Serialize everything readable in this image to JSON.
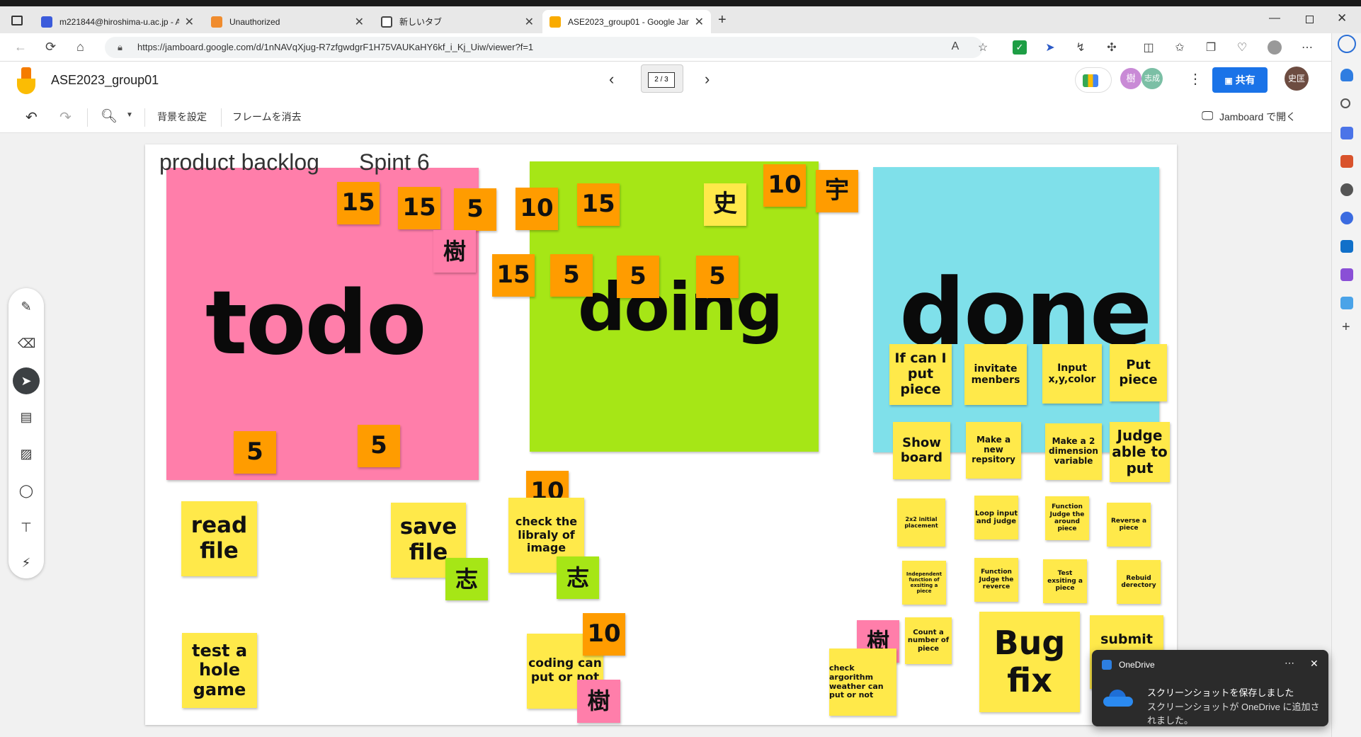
{
  "browser": {
    "tabs": [
      {
        "title": "m221844@hiroshima-u.ac.jp - A"
      },
      {
        "title": "Unauthorized"
      },
      {
        "title": "新しいタブ"
      },
      {
        "title": "ASE2023_group01 - Google Jam"
      }
    ],
    "url": "https://jamboard.google.com/d/1nNAVqXjug-R7zfgwdgrF1H75VAUKaHY6kf_i_Kj_Uiw/viewer?f=1"
  },
  "jam": {
    "title": "ASE2023_group01",
    "frame_indicator": "2 / 3",
    "avatars": [
      "樹",
      "志成"
    ],
    "share_label": "共有",
    "profile_initial": "史匡",
    "toolbar": {
      "set_background": "背景を設定",
      "clear_frame": "フレームを消去",
      "open_in_jamboard": "Jamboard で開く"
    }
  },
  "board": {
    "heading_left": "product backlog",
    "heading_right": "Spint 6",
    "todo": "todo",
    "doing": "doing",
    "done": "done",
    "stickies": {
      "o15a": "15",
      "o15b": "15",
      "o5a": "5",
      "o10a": "10",
      "o15c": "15",
      "kanji_shi": "史",
      "o10b": "10",
      "kanji_u": "宇",
      "kanji_ki1": "樹",
      "o15d": "15",
      "o5b": "5",
      "o5c": "5",
      "o5d": "5",
      "o5e": "5",
      "o5f": "5",
      "if_can_put": "If can I put piece",
      "invitate": "invitate menbers",
      "input_xy": "Input x,y,color",
      "put_piece": "Put piece",
      "show_board": "Show board",
      "make_repo": "Make a new repsitory",
      "make_2d": "Make a 2 dimension variable",
      "judge_able": "Judge able to put",
      "initial_placement": "2x2 initial placement",
      "loop_input": "Loop input and judge",
      "func_judge_around": "Function Judge the around piece",
      "reverse_piece": "Reverse a piece",
      "independent_func": "Independent function of exsiting a piece",
      "func_judge_reverse": "Function Judge the reverce",
      "test_existing": "Test exsiting a piece",
      "rebuild_dir": "Rebuid derectory",
      "read_file": "read file",
      "save_file": "save file",
      "kanji_shi2": "志",
      "o10c": "10",
      "check_lib": "check the libraly of image",
      "kanji_shi3": "志",
      "test_hole": "test a hole game",
      "o10d": "10",
      "coding_put": "coding can put or not",
      "kanji_ki2": "樹",
      "kanji_ki3": "樹",
      "check_algo": "check argorithm weather can put or not",
      "count_piece": "Count a number of piece",
      "bug_fix": "Bug fix",
      "submit": "submit"
    }
  },
  "toast": {
    "app": "OneDrive",
    "line1": "スクリーンショットを保存しました",
    "line2": "スクリーンショットが OneDrive に追加されました。"
  }
}
